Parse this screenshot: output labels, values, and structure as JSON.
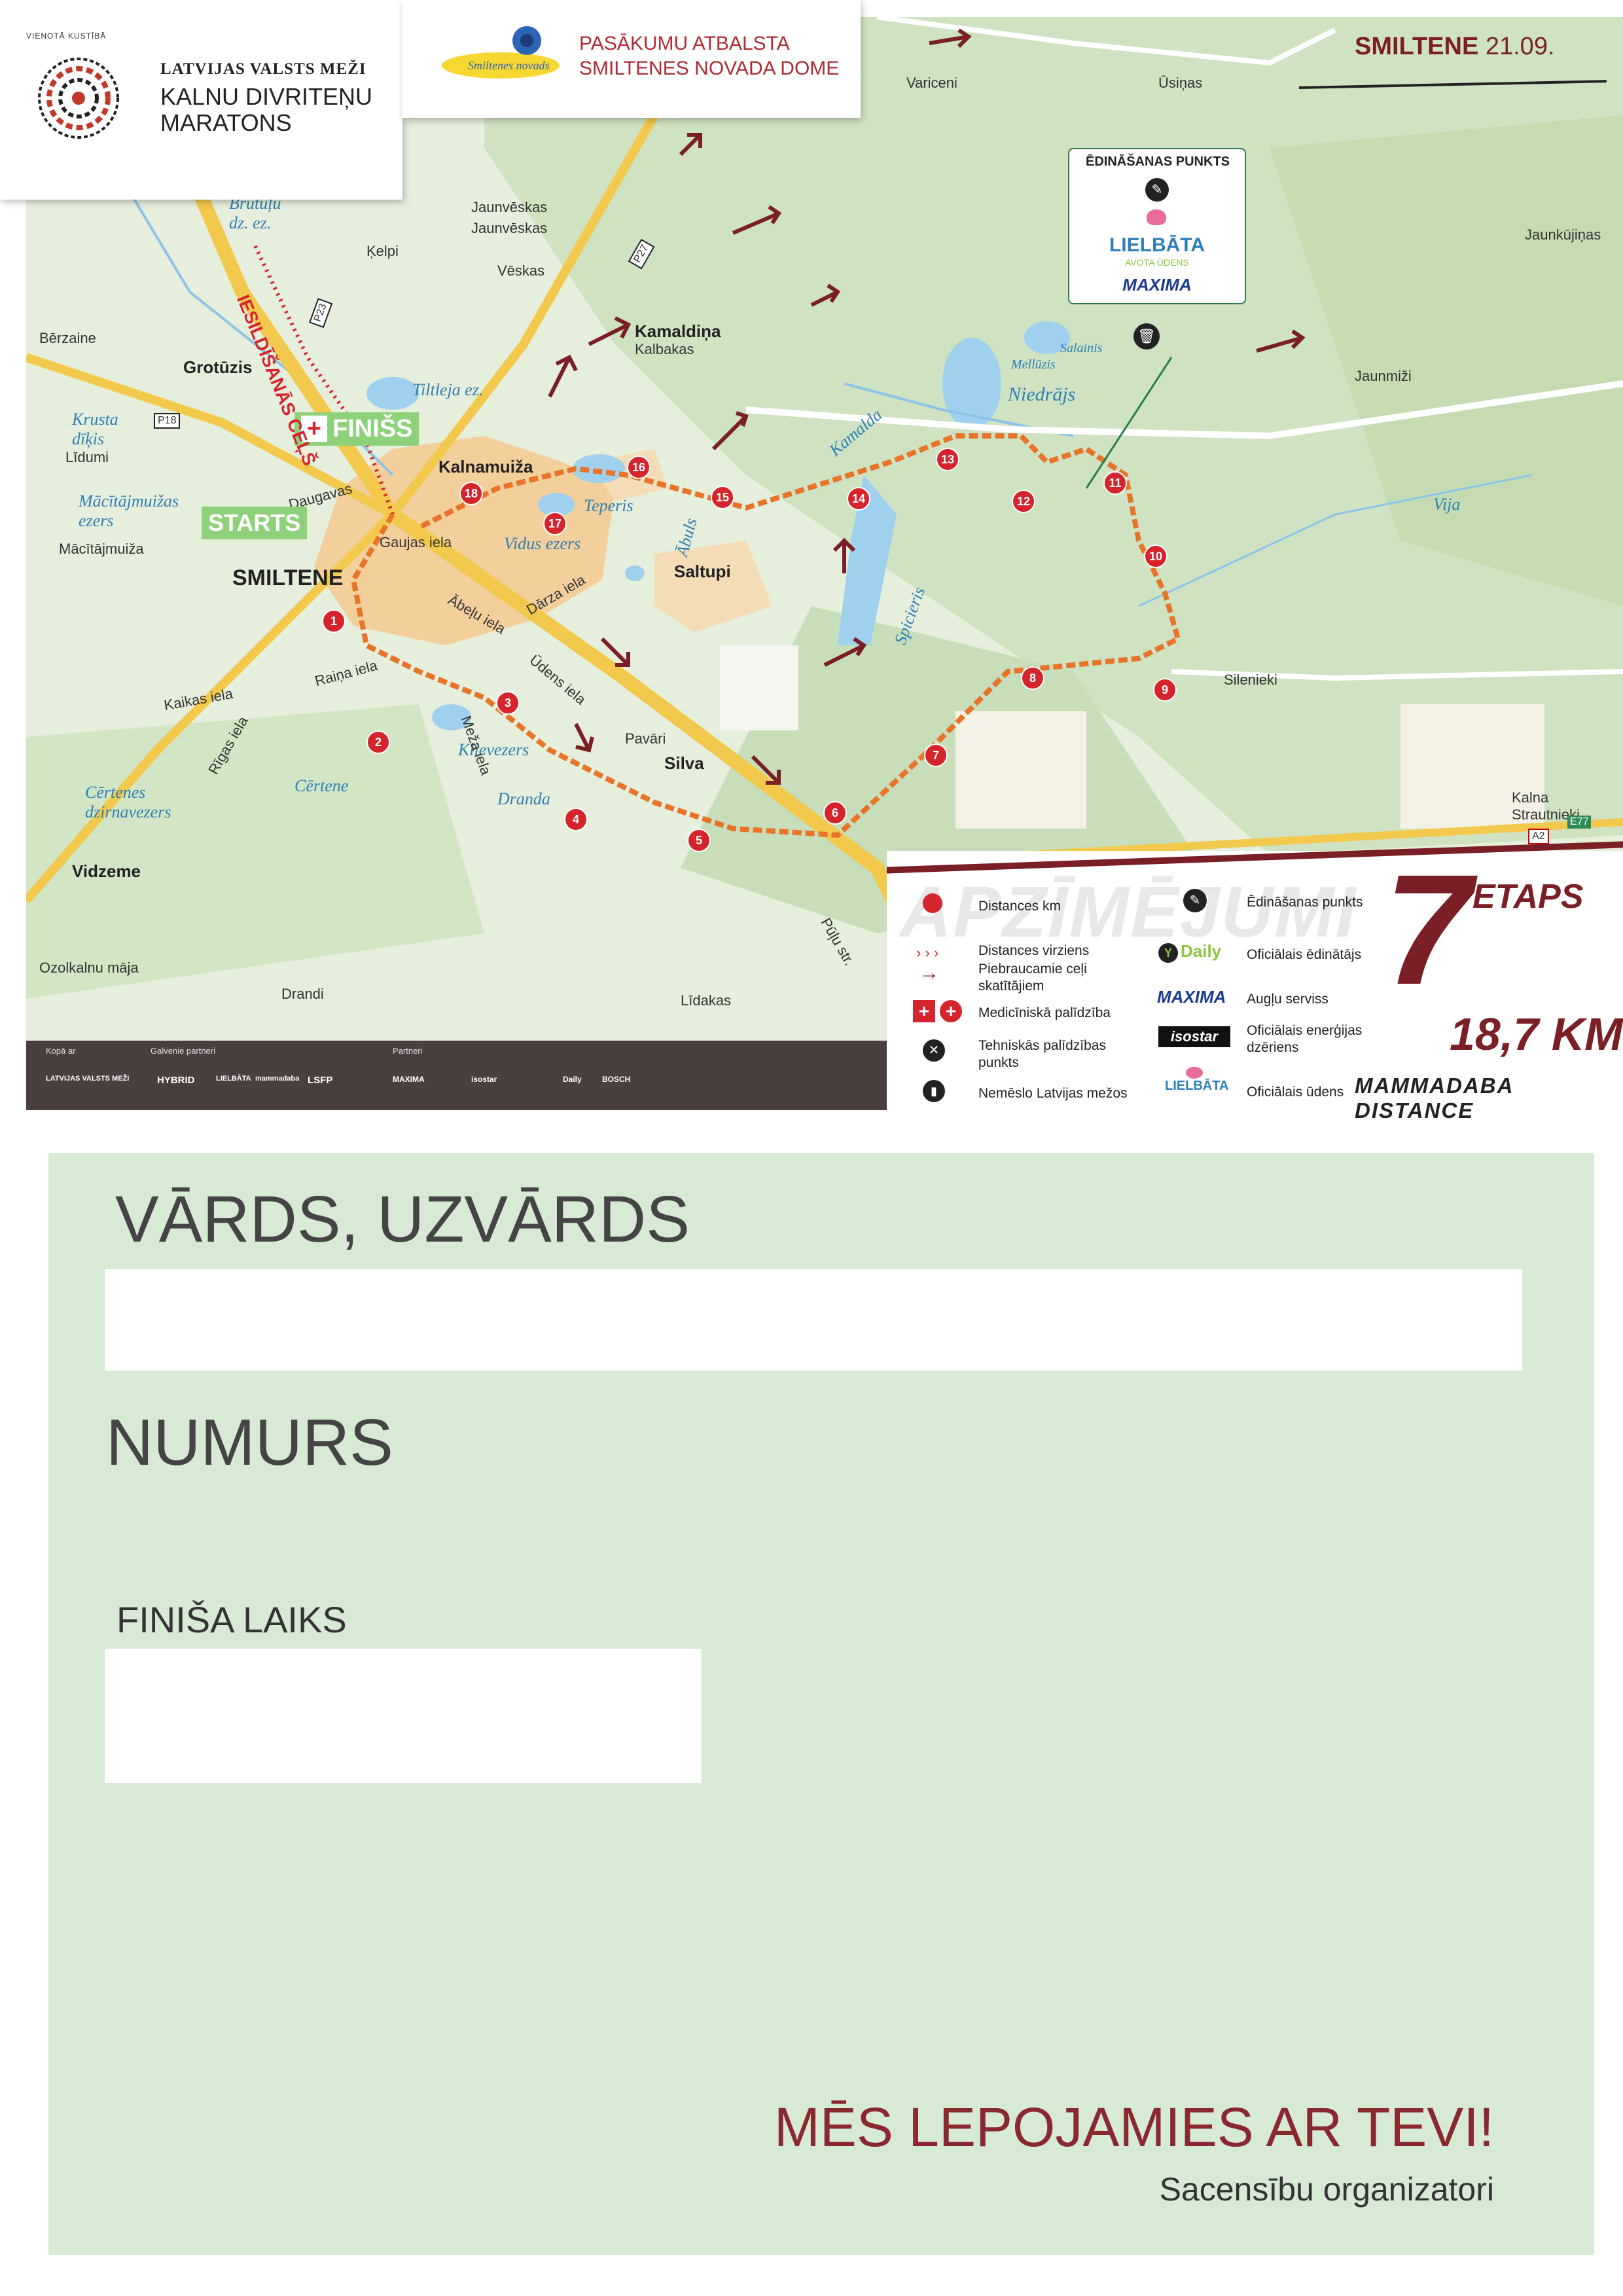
{
  "header": {
    "org_line1": "LATVIJAS VALSTS MEŽI",
    "org_line2": "KALNU DIVRITEŅU MARATONS",
    "logo_ring_text": "VIENOTĀ KUSTĪBĀ",
    "support_line1": "PASĀKUMU ATBALSTA",
    "support_line2": "SMILTENES NOVADA DOME",
    "smiltene_logo_text": "Smiltenes novads",
    "event_place": "SMILTENE",
    "event_date": "21.09."
  },
  "map": {
    "finish_label": "FINIŠS",
    "start_label": "STARTS",
    "warmup_label": "IESILDĪŠANĀS CEĻŠ",
    "town_labels": [
      "SMILTENE",
      "Grotūzis",
      "Kalnamuiža",
      "Saltupi",
      "Silva",
      "Kamaldiņa",
      "Vidzeme",
      "Mācītājmuiža",
      "Pavāri",
      "Variceni",
      "Ūsiņas",
      "Ķelpi",
      "Jaunvēskas",
      "Vēskas",
      "Kalbakas",
      "Bērzaine",
      "Līdumi",
      "Jaunmiži",
      "Jaunkūjiņas",
      "Silenieki",
      "Kalna Strautnieki",
      "Ozolkalnu māja",
      "Drandi",
      "Līdakas"
    ],
    "water_labels": [
      "Tiltleja ez.",
      "Teperis",
      "Vidus ezers",
      "Niedrājs",
      "Salainis",
      "Mellūzis",
      "Spicieris",
      "Klievezers",
      "Dranda",
      "Vija",
      "Ābuls",
      "Kamalda",
      "Cērtene",
      "Cērtenes dzirnavezers",
      "Mācītājmuižas ezers",
      "Krusta dīķis",
      "Brutuļu dz. ez.",
      "Daugavas",
      "Gaujas iela",
      "Dārza iela",
      "Ābeļu iela",
      "Raiņa iela",
      "Kaikas iela",
      "Rīgas iela",
      "Ūdens iela",
      "Pūļu str.",
      "Meža iela",
      "Jaunvēskas"
    ],
    "road_labels": [
      "P23",
      "P18",
      "P27",
      "A2",
      "E77"
    ],
    "km_markers": [
      "1",
      "2",
      "3",
      "4",
      "5",
      "6",
      "7",
      "8",
      "9",
      "10",
      "11",
      "12",
      "13",
      "14",
      "15",
      "16",
      "17",
      "18"
    ],
    "feed_box": {
      "title": "ĒDINĀŠANAS PUNKTS",
      "brand1": "LIELBĀTA",
      "brand2": "AVOTA ŪDENS",
      "brand3": "MAXIMA"
    }
  },
  "legend": {
    "watermark": "APZĪMĒJUMI",
    "items": [
      {
        "label": "Distances km"
      },
      {
        "label": "Distances virziens"
      },
      {
        "label": "Piebraucamie ceļi skatītājiem"
      },
      {
        "label": "Medicīniskā palīdzība"
      },
      {
        "label": "Tehniskās palīdzības punkts"
      },
      {
        "label": "Nemēslo Latvijas mežos"
      },
      {
        "label": "Ēdināšanas punkts"
      },
      {
        "label": "Oficiālais ēdinātājs"
      },
      {
        "label": "Augļu serviss"
      },
      {
        "label": "Oficiālais enerģijas dzēriens"
      },
      {
        "label": "Oficiālais ūdens"
      }
    ],
    "brands": {
      "daily": "Daily",
      "maxima": "MAXIMA",
      "isostar": "isostar",
      "lielbata": "LIELBĀTA"
    }
  },
  "stage": {
    "number": "7",
    "label": "ETAPS",
    "distance": "18,7 KM",
    "distance_name": "MAMMADABA DISTANCE"
  },
  "partners": {
    "label1": "Kopā ar",
    "label2": "Galvenie partneri",
    "label3": "Partneri",
    "logos": [
      "LATVIJAS VALSTS MEŽI",
      "HYBRID",
      "LIELBĀTA",
      "mammadaba",
      "LSFP",
      "MAXIMA",
      "isostar",
      "Daily",
      "BOSCH"
    ]
  },
  "form": {
    "name_label": "VĀRDS, UZVĀRDS",
    "number_label": "NUMURS",
    "finish_time_label": "FINIŠA LAIKS",
    "pride_text": "MĒS LEPOJAMIES AR TEVI!",
    "organizers_text": "Sacensību organizatori"
  },
  "colors": {
    "brand_red": "#7a1f26",
    "route_orange": "#e8742a",
    "marker_red": "#d4242c",
    "panel_green": "#d7ead4",
    "start_green": "#8fd17b"
  }
}
